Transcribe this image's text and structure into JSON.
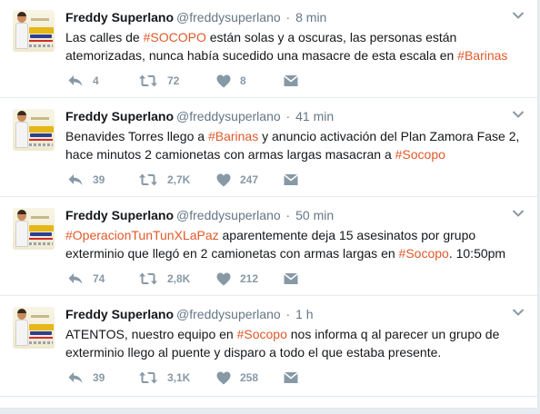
{
  "tweets": [
    {
      "name": "Freddy Superlano",
      "handle": "@freddysuperlano",
      "separator": "·",
      "time": "8 min",
      "text": [
        {
          "t": "Las calles de ",
          "tag": false
        },
        {
          "t": "#SOCOPO",
          "tag": true
        },
        {
          "t": " están solas y a oscuras, las personas están atemorizadas, nunca había sucedido una masacre de esta escala en ",
          "tag": false
        },
        {
          "t": "#Barinas",
          "tag": true
        }
      ],
      "replies": "4",
      "retweets": "72",
      "likes": "8"
    },
    {
      "name": "Freddy Superlano",
      "handle": "@freddysuperlano",
      "separator": "·",
      "time": "41 min",
      "text": [
        {
          "t": "Benavides Torres llego a ",
          "tag": false
        },
        {
          "t": "#Barinas",
          "tag": true
        },
        {
          "t": " y anuncio activación del Plan Zamora Fase 2, hace minutos 2 camionetas con armas largas masacran a ",
          "tag": false
        },
        {
          "t": "#Socopo",
          "tag": true
        }
      ],
      "replies": "39",
      "retweets": "2,7K",
      "likes": "247"
    },
    {
      "name": "Freddy Superlano",
      "handle": "@freddysuperlano",
      "separator": "·",
      "time": "50 min",
      "text": [
        {
          "t": "#OperacionTunTunXLaPaz",
          "tag": true
        },
        {
          "t": " aparentemente deja 15 asesinatos por grupo exterminio que llegó en 2 camionetas con armas largas en ",
          "tag": false
        },
        {
          "t": "#Socopo",
          "tag": true
        },
        {
          "t": ". 10:50pm",
          "tag": false
        }
      ],
      "replies": "74",
      "retweets": "2,8K",
      "likes": "212"
    },
    {
      "name": "Freddy Superlano",
      "handle": "@freddysuperlano",
      "separator": "·",
      "time": "1 h",
      "text": [
        {
          "t": "ATENTOS, nuestro equipo en ",
          "tag": false
        },
        {
          "t": "#Socopo",
          "tag": true
        },
        {
          "t": " nos informa q al parecer un grupo de exterminio llego al puente y disparo a todo el que estaba presente.",
          "tag": false
        }
      ],
      "replies": "39",
      "retweets": "3,1K",
      "likes": "258"
    }
  ],
  "icons": {
    "reply": "reply-icon",
    "retweet": "retweet-icon",
    "like": "heart-icon",
    "dm": "envelope-icon",
    "more": "chevron-down-icon"
  },
  "colors": {
    "hashtag": "#e0592a",
    "action": "#8899a6",
    "muted": "#657786"
  }
}
